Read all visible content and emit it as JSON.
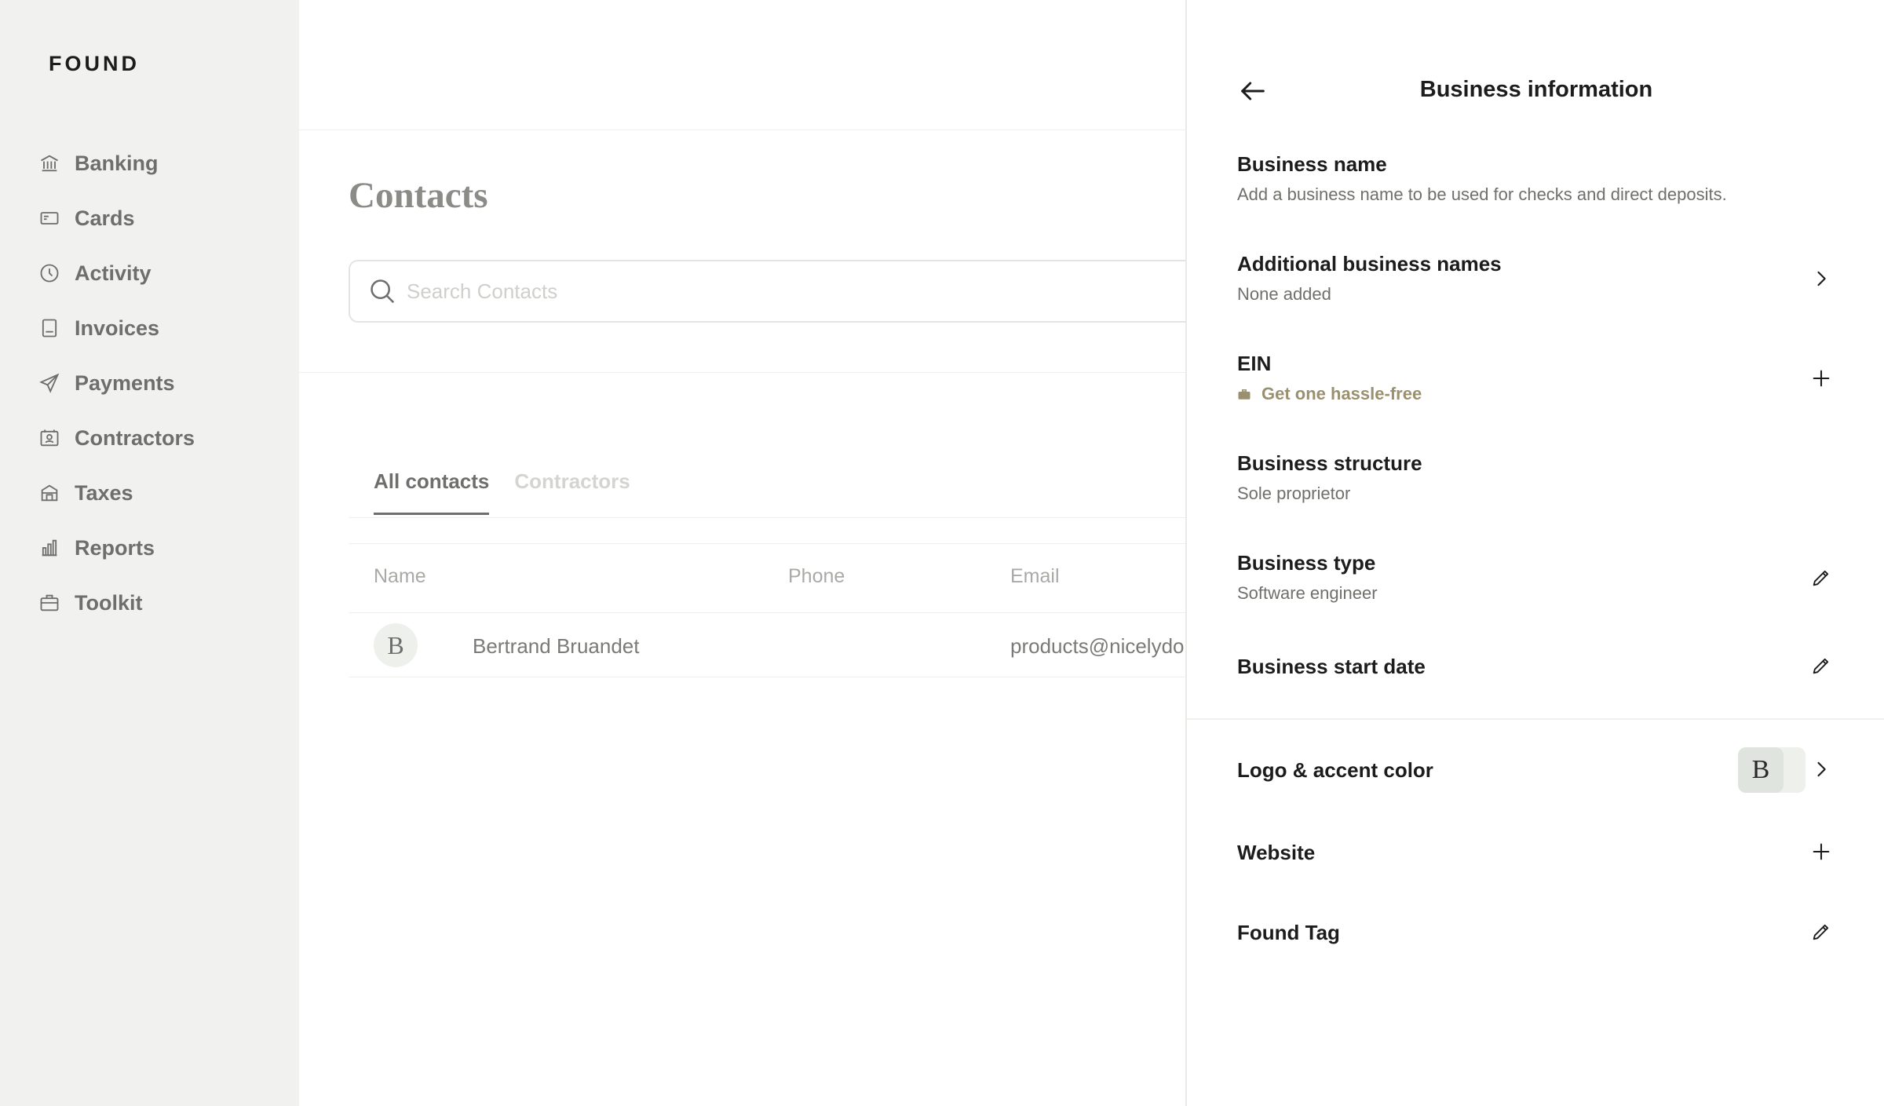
{
  "sidebar": {
    "logo": "FOUND",
    "items": [
      {
        "label": "Banking",
        "icon": "bank-icon"
      },
      {
        "label": "Cards",
        "icon": "card-icon"
      },
      {
        "label": "Activity",
        "icon": "clock-icon"
      },
      {
        "label": "Invoices",
        "icon": "invoice-icon"
      },
      {
        "label": "Payments",
        "icon": "send-icon"
      },
      {
        "label": "Contractors",
        "icon": "contractor-icon"
      },
      {
        "label": "Taxes",
        "icon": "tax-icon"
      },
      {
        "label": "Reports",
        "icon": "chart-icon"
      },
      {
        "label": "Toolkit",
        "icon": "briefcase-icon"
      }
    ]
  },
  "main": {
    "title": "Contacts",
    "search_placeholder": "Search Contacts",
    "tabs": [
      {
        "label": "All contacts",
        "active": true
      },
      {
        "label": "Contractors",
        "active": false
      }
    ],
    "table": {
      "columns": [
        "Name",
        "Phone",
        "Email"
      ],
      "rows": [
        {
          "initial": "B",
          "name": "Bertrand Bruandet",
          "phone": "",
          "email": "products@nicelydor"
        }
      ]
    }
  },
  "panel": {
    "title": "Business information",
    "items": [
      {
        "label": "Business name",
        "sub": "Add a business name to be used for checks and direct deposits.",
        "action": ""
      },
      {
        "label": "Additional business names",
        "sub": "None added",
        "action": "chevron-right-icon"
      },
      {
        "label": "EIN",
        "sub": "Get one hassle-free",
        "action": "plus-icon"
      },
      {
        "label": "Business structure",
        "sub": "Sole proprietor",
        "action": ""
      },
      {
        "label": "Business type",
        "sub": "Software engineer",
        "action": "pencil-icon"
      },
      {
        "label": "Business start date",
        "sub": "",
        "action": "pencil-icon"
      },
      {
        "label": "Logo & accent color",
        "sub": "",
        "action": "chevron-right-icon",
        "logo_initial": "B"
      },
      {
        "label": "Website",
        "sub": "",
        "action": "plus-icon"
      },
      {
        "label": "Found Tag",
        "sub": "",
        "action": "pencil-icon"
      }
    ]
  },
  "colors": {
    "sidebar_bg": "#f1f2ef",
    "accent_text": "#9a9070",
    "muted_text": "#6e6f6c"
  }
}
